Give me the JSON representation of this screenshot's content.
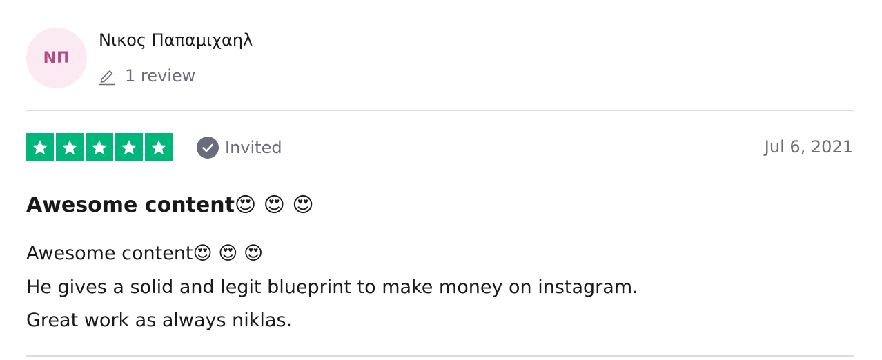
{
  "consumer": {
    "initials": "NΠ",
    "name": "Νικος Παπαμιχαηλ",
    "review_count": "1 review",
    "avatar_bg": "#fbeaf2",
    "avatar_text_color": "#b24d84"
  },
  "review": {
    "rating": 5,
    "rating_max": 5,
    "star_color": "#00b67a",
    "invited_label": "Invited",
    "date": "Jul 6, 2021",
    "title": "Awesome content😍 😍 😍",
    "body_lines": [
      "Awesome content😍 😍 😍",
      "He gives a solid and legit blueprint to make money on instagram.",
      "Great work as always niklas."
    ]
  },
  "icons": {
    "pencil": "pencil-icon",
    "check": "check-circle-icon",
    "star": "star-icon"
  }
}
